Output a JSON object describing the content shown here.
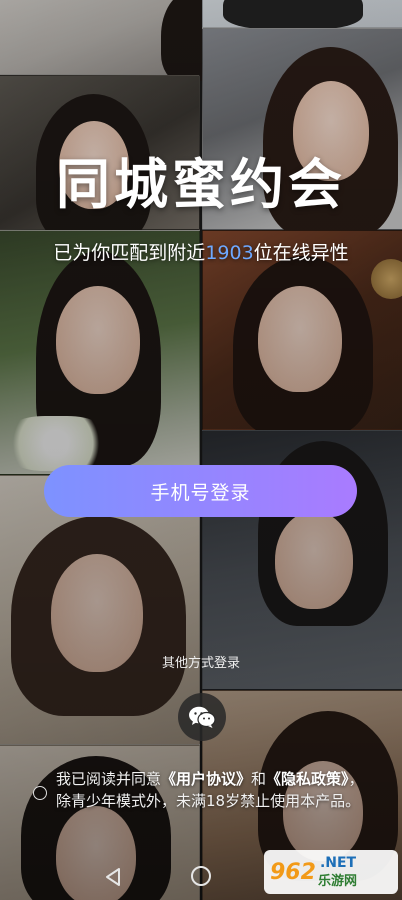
{
  "app": {
    "title": "同城蜜约会",
    "subtitle_prefix": "已为你匹配到附近",
    "match_count": "1903",
    "subtitle_suffix": "位在线异性"
  },
  "login": {
    "phone_label": "手机号登录",
    "other_methods": "其他方式登录"
  },
  "agreement": {
    "prefix": "我已阅读并同意",
    "user_agreement": "《用户协议》",
    "and": "和",
    "privacy_policy": "《隐私政策》",
    "suffix": "，除青少年模式外，未满18岁禁止使用本产品。"
  },
  "watermark": {
    "number": "962",
    "domain": ".NET",
    "site_name": "乐游网"
  },
  "colors": {
    "accent": "#6ea8ff",
    "button_start": "#7d92ff",
    "button_end": "#a97bff"
  },
  "icons": {
    "wechat": "wechat-icon",
    "nav_back": "back-triangle-icon",
    "nav_home": "home-circle-icon"
  }
}
